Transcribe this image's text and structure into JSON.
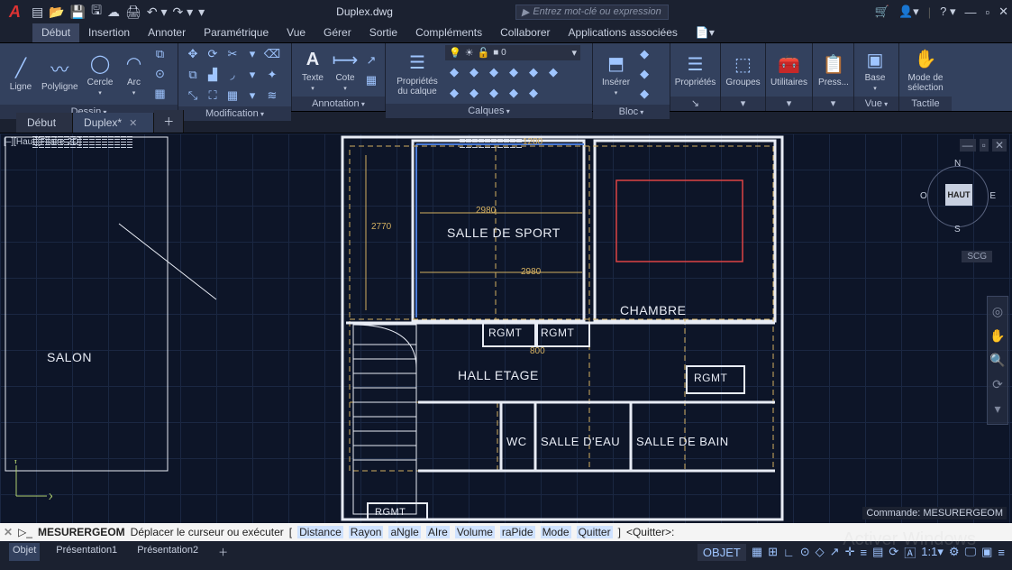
{
  "title": "Duplex.dwg",
  "search_placeholder": "Entrez mot-clé ou expression",
  "menubar": [
    "Début",
    "Insertion",
    "Annoter",
    "Paramétrique",
    "Vue",
    "Gérer",
    "Sortie",
    "Compléments",
    "Collaborer",
    "Applications associées"
  ],
  "menubar_active": 0,
  "ribbon": {
    "dessin": {
      "label": "Dessin",
      "items": [
        "Ligne",
        "Polyligne",
        "Cercle",
        "Arc"
      ]
    },
    "modif": {
      "label": "Modification"
    },
    "annot": {
      "label": "Annotation",
      "items": [
        "Texte",
        "Cote"
      ]
    },
    "calques": {
      "label": "Calques",
      "props": "Propriétés du calque"
    },
    "bloc": {
      "label": "Bloc",
      "item": "Insérer"
    },
    "props": {
      "label": "Propriétés"
    },
    "groupes": {
      "label": "Groupes"
    },
    "util": {
      "label": "Utilitaires"
    },
    "press": {
      "label": "Press..."
    },
    "vue": {
      "label": "Vue",
      "item": "Base"
    },
    "tactile": {
      "label": "Tactile",
      "item": "Mode de sélection"
    }
  },
  "doctabs": [
    {
      "label": "Début",
      "active": false
    },
    {
      "label": "Duplex*",
      "active": true
    }
  ],
  "view_annotation": "[–][Haut][Filaire 2D]",
  "viewcube": {
    "face": "HAUT",
    "n": "N",
    "s": "S",
    "e": "E",
    "o": "O",
    "scg": "SCG"
  },
  "rooms": {
    "salon": "SALON",
    "sport": "SALLE DE SPORT",
    "chambre": "CHAMBRE",
    "rgmt": "RGMT",
    "hall": "HALL ETAGE",
    "wc": "WC",
    "eau": "SALLE D'EAU",
    "bain": "SALLE DE BAIN"
  },
  "dims": {
    "d1": "2770",
    "d2": "2980",
    "d3": "2980",
    "d4": "1200",
    "d5": "800"
  },
  "cmd_corner": "Commande: MESURERGEOM",
  "cmd": {
    "name": "MESURERGEOM",
    "text": "Déplacer le curseur ou exécuter",
    "opts": [
      "Distance",
      "Rayon",
      "aNgle",
      "AIre",
      "Volume",
      "raPide",
      "Mode",
      "Quitter"
    ],
    "prompt": "<Quitter>:"
  },
  "status": {
    "tabs": [
      "Objet",
      "Présentation1",
      "Présentation2"
    ],
    "active": 0,
    "objet_label": "OBJET"
  },
  "watermark": "Activer Windows"
}
